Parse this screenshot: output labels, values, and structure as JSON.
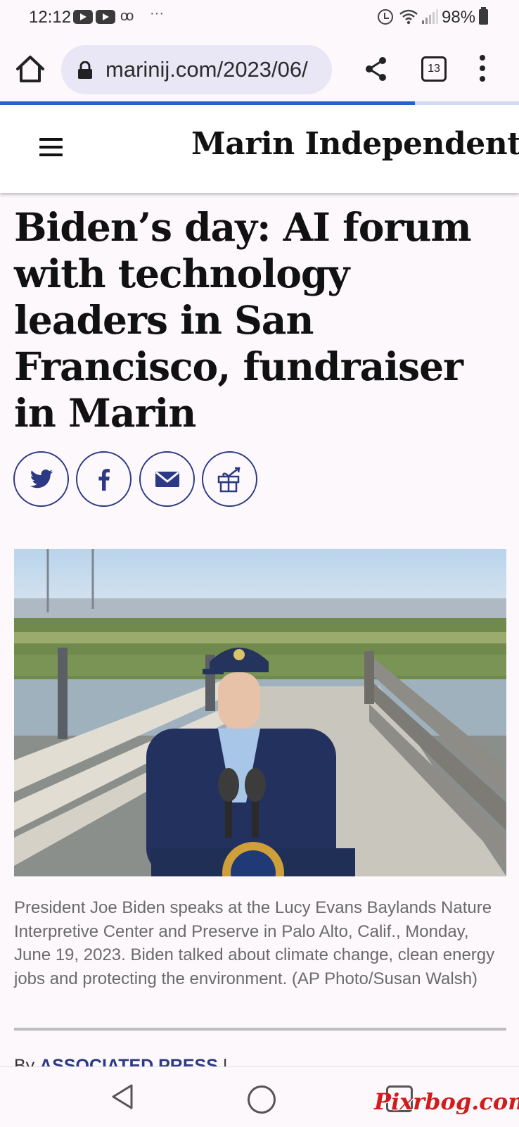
{
  "status_bar": {
    "time": "12:12",
    "notification_icons": [
      "youtube-icon",
      "youtube-icon",
      "voicemail-icon"
    ],
    "more_indicator": "···",
    "battery": "98%"
  },
  "browser": {
    "url": "marinij.com/2023/06/",
    "tab_count": "13",
    "page_load_progress": 0.8
  },
  "site": {
    "masthead": "Marin Independent Journal"
  },
  "article": {
    "headline": "Biden’s day: AI forum with technology leaders in San Francisco, fundraiser in Marin",
    "share_buttons": [
      "twitter-icon",
      "facebook-icon",
      "email-icon",
      "gift-icon"
    ],
    "caption": "President Joe Biden speaks at the Lucy Evans Baylands Nature Interpretive Center and Preserve in Palo Alto, Calif., Monday, June 19, 2023. Biden talked about climate change, clean energy jobs and protecting the environment. (AP Photo/Susan Walsh)",
    "byline_prefix": "By",
    "byline_author": "ASSOCIATED PRESS",
    "byline_separator": "|"
  },
  "watermark": "Pixrbog.com",
  "colors": {
    "accent": "#2c3a85",
    "progress": "#2a62c9",
    "watermark": "#d41b1b"
  }
}
